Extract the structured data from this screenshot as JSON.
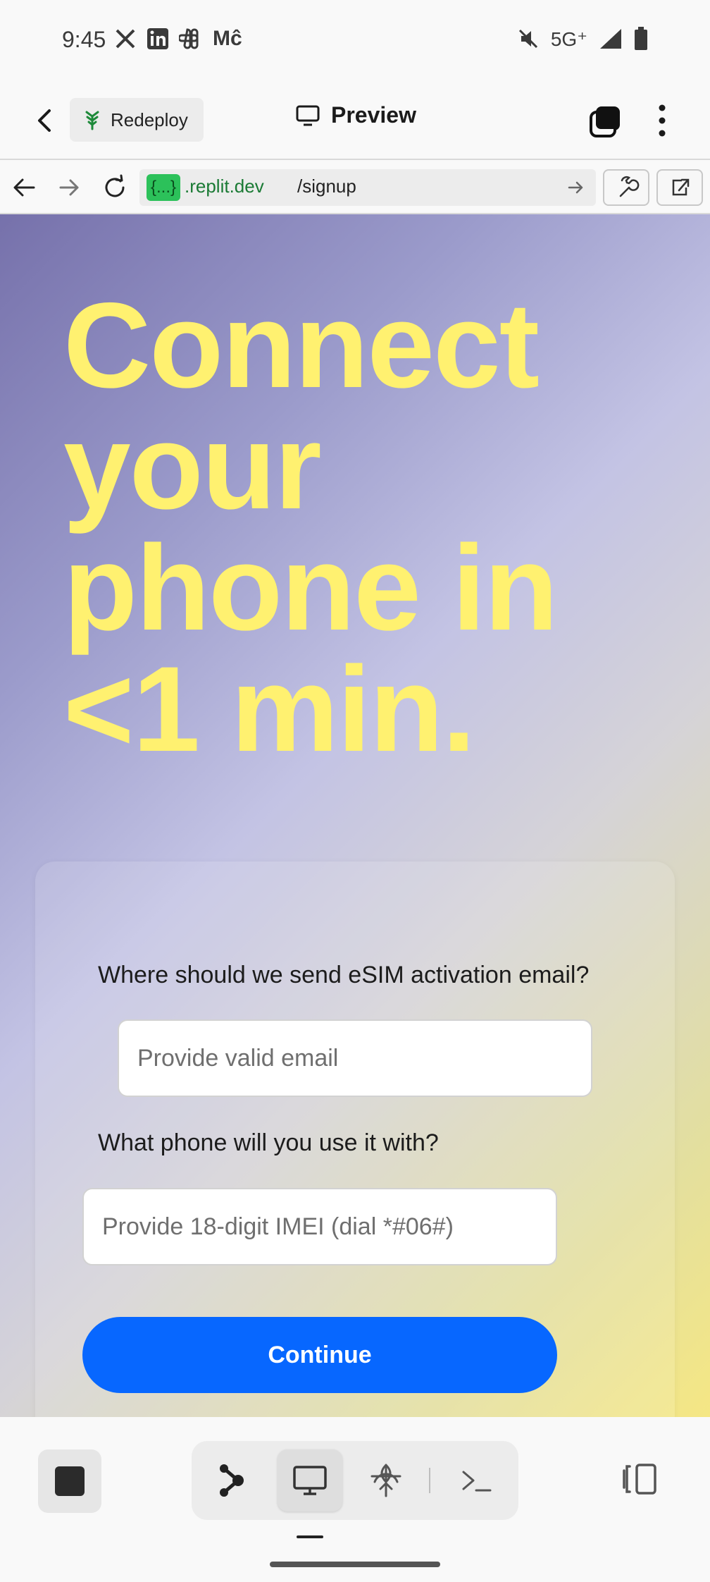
{
  "status_bar": {
    "time": "9:45",
    "notification_icons": [
      "x-icon",
      "linkedin-icon",
      "slack-icon",
      "medium-icon"
    ],
    "medium_glyph": "Mĉ",
    "network": "5G⁺",
    "right_icons": [
      "mute-icon",
      "signal-icon",
      "battery-icon"
    ]
  },
  "topbar": {
    "redeploy_label": "Redeploy",
    "preview_label": "Preview"
  },
  "urlbar": {
    "badge": "{...}",
    "host": ".replit.dev",
    "path": "/signup"
  },
  "page": {
    "headline_lines": [
      "Connect",
      "your",
      "phone in",
      "<1 min."
    ],
    "email_question": "Where should we send eSIM activation email?",
    "email_placeholder": "Provide valid email",
    "phone_question": "What phone will you use it with?",
    "imei_placeholder": "Provide 18-digit IMEI (dial *#06#)",
    "continue_label": "Continue"
  },
  "colors": {
    "headline": "#fff170",
    "primary_button": "#0767ff",
    "url_badge": "#2cc15a"
  }
}
